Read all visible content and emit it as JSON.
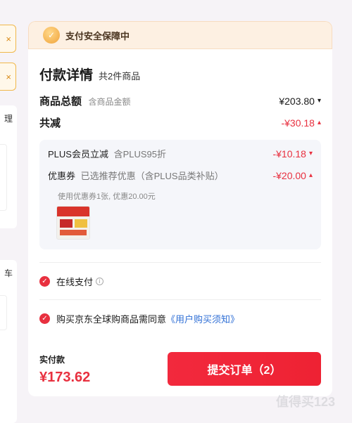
{
  "left": {
    "close_glyph": "×",
    "partial_text_1": "理",
    "partial_text_2": "车"
  },
  "security": {
    "icon_glyph": "✓",
    "text": "支付安全保障中"
  },
  "payment": {
    "title": "付款详情",
    "item_count": "共2件商品",
    "total": {
      "label": "商品总额",
      "sublabel": "含商品金额",
      "value": "¥203.80"
    },
    "reduction": {
      "label": "共减",
      "value": "-¥30.18"
    },
    "details": {
      "plus": {
        "label": "PLUS会员立减",
        "sublabel": "含PLUS95折",
        "value": "-¥10.18"
      },
      "coupon": {
        "label": "优惠券",
        "sublabel": "已选推荐优惠（含PLUS品类补贴）",
        "value": "-¥20.00"
      },
      "coupon_note": "使用优惠券1张, 优惠20.00元"
    }
  },
  "options": {
    "online_pay": "在线支付",
    "agreement_prefix": "购买京东全球购商品需同意",
    "agreement_link": "《用户购买须知》"
  },
  "footer": {
    "pay_label": "实付款",
    "pay_amount": "¥173.62",
    "submit_label": "提交订单（2）"
  },
  "watermark": "值得买123",
  "icons": {
    "chevron_down": "▾",
    "chevron_up": "▴",
    "check": "✓",
    "info": "i"
  },
  "colors": {
    "accent_red": "#e8303f",
    "link_blue": "#2f6fd6",
    "security_bg": "#fdf0e2"
  }
}
